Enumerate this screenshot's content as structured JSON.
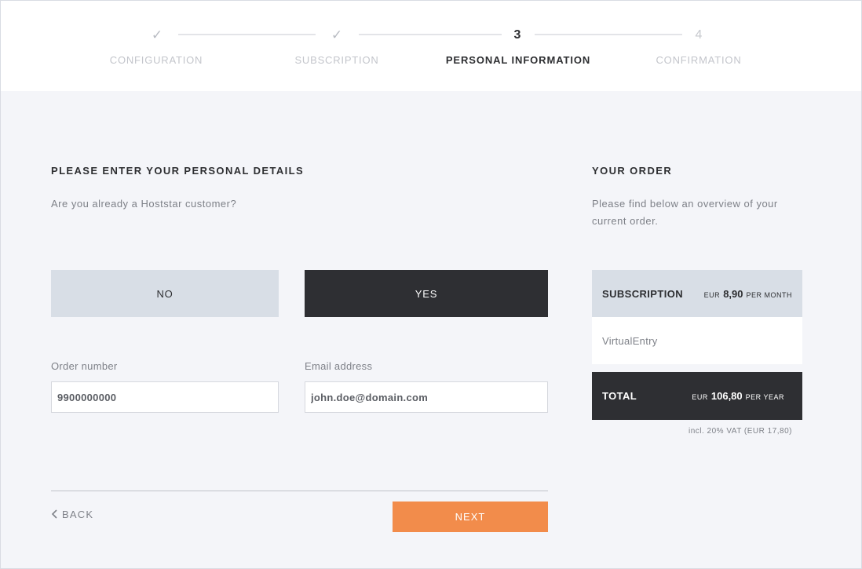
{
  "stepper": {
    "steps": [
      {
        "mark": "✓",
        "label": "CONFIGURATION",
        "state": "done"
      },
      {
        "mark": "✓",
        "label": "SUBSCRIPTION",
        "state": "done"
      },
      {
        "mark": "3",
        "label": "PERSONAL INFORMATION",
        "state": "active"
      },
      {
        "mark": "4",
        "label": "CONFIRMATION",
        "state": "future"
      }
    ]
  },
  "form": {
    "title": "PLEASE ENTER YOUR PERSONAL DETAILS",
    "question": "Are you already a Hoststar customer?",
    "choice_no": "NO",
    "choice_yes": "YES",
    "order_number": {
      "label": "Order number",
      "value": "9900000000"
    },
    "email": {
      "label": "Email address",
      "value": "john.doe@domain.com"
    },
    "back_label": "BACK",
    "next_label": "NEXT"
  },
  "order": {
    "title": "YOUR ORDER",
    "description": "Please find below an overview of your current order.",
    "subscription": {
      "label": "SUBSCRIPTION",
      "currency": "EUR",
      "amount": "8,90",
      "period": "PER MONTH"
    },
    "item": "VirtualEntry",
    "total": {
      "label": "TOTAL",
      "currency": "EUR",
      "amount": "106,80",
      "period": "PER YEAR"
    },
    "vat_note": "incl. 20% VAT (EUR 17,80)"
  },
  "colors": {
    "accent": "#f28c4b",
    "dark": "#2e2f33",
    "light_panel": "#d8dee6",
    "background": "#f4f5f9"
  }
}
